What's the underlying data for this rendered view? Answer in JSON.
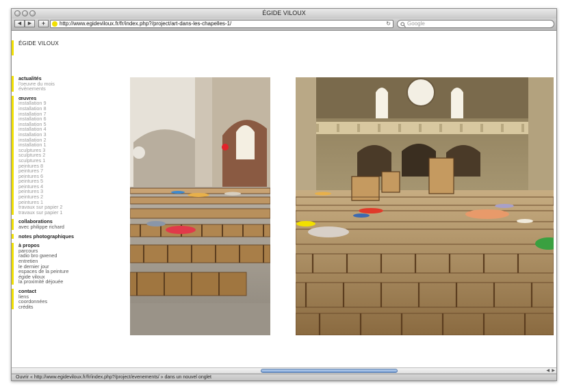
{
  "window": {
    "title": "ÉGIDE VILOUX"
  },
  "toolbar": {
    "back": "◀",
    "forward": "▶",
    "add": "+",
    "url": "http://www.egideviloux.fr/fr/index.php?/project/art-dans-les-chapelles-1/",
    "reload": "↻",
    "search_placeholder": "Google"
  },
  "site": {
    "brand": "ÉGIDE VILOUX"
  },
  "nav": {
    "groups": [
      {
        "head": "actualités",
        "items": [
          "l'oeuvre du mois",
          "évènements"
        ]
      },
      {
        "head": "œuvres",
        "items": [
          "installation 9",
          "installation 8",
          "installation 7",
          "installation 6",
          "installation 5",
          "installation 4",
          "installation 3",
          "installation 2",
          "installation 1",
          "sculptures 3",
          "sculptures 2",
          "sculptures 1",
          "peintures 8",
          "peintures 7",
          "peintures 6",
          "peintures 5",
          "peintures 4",
          "peintures 3",
          "peintures 2",
          "peintures 1",
          "travaux sur papier 2",
          "travaux sur papier 1"
        ]
      },
      {
        "head": "collaborations",
        "items": [
          "avec philippe richard"
        ]
      },
      {
        "head": "notes photographiques",
        "items": []
      },
      {
        "head": "à propos",
        "items": [
          "parcours",
          "radio bro gwened",
          "entretien",
          "le dernier jour",
          "espaces de la peinture",
          "égide viloux",
          "la proximité déjouée"
        ]
      },
      {
        "head": "contact",
        "items": [
          "liens",
          "coordonnées",
          "crédits"
        ]
      }
    ]
  },
  "status": {
    "text": "Ouvrir « http://www.egideviloux.fr/fr/index.php?/project/evenements/ » dans un nouvel onglet"
  },
  "colors": {
    "accent": "#f2e000",
    "text": "#222222",
    "muted": "#999999"
  }
}
